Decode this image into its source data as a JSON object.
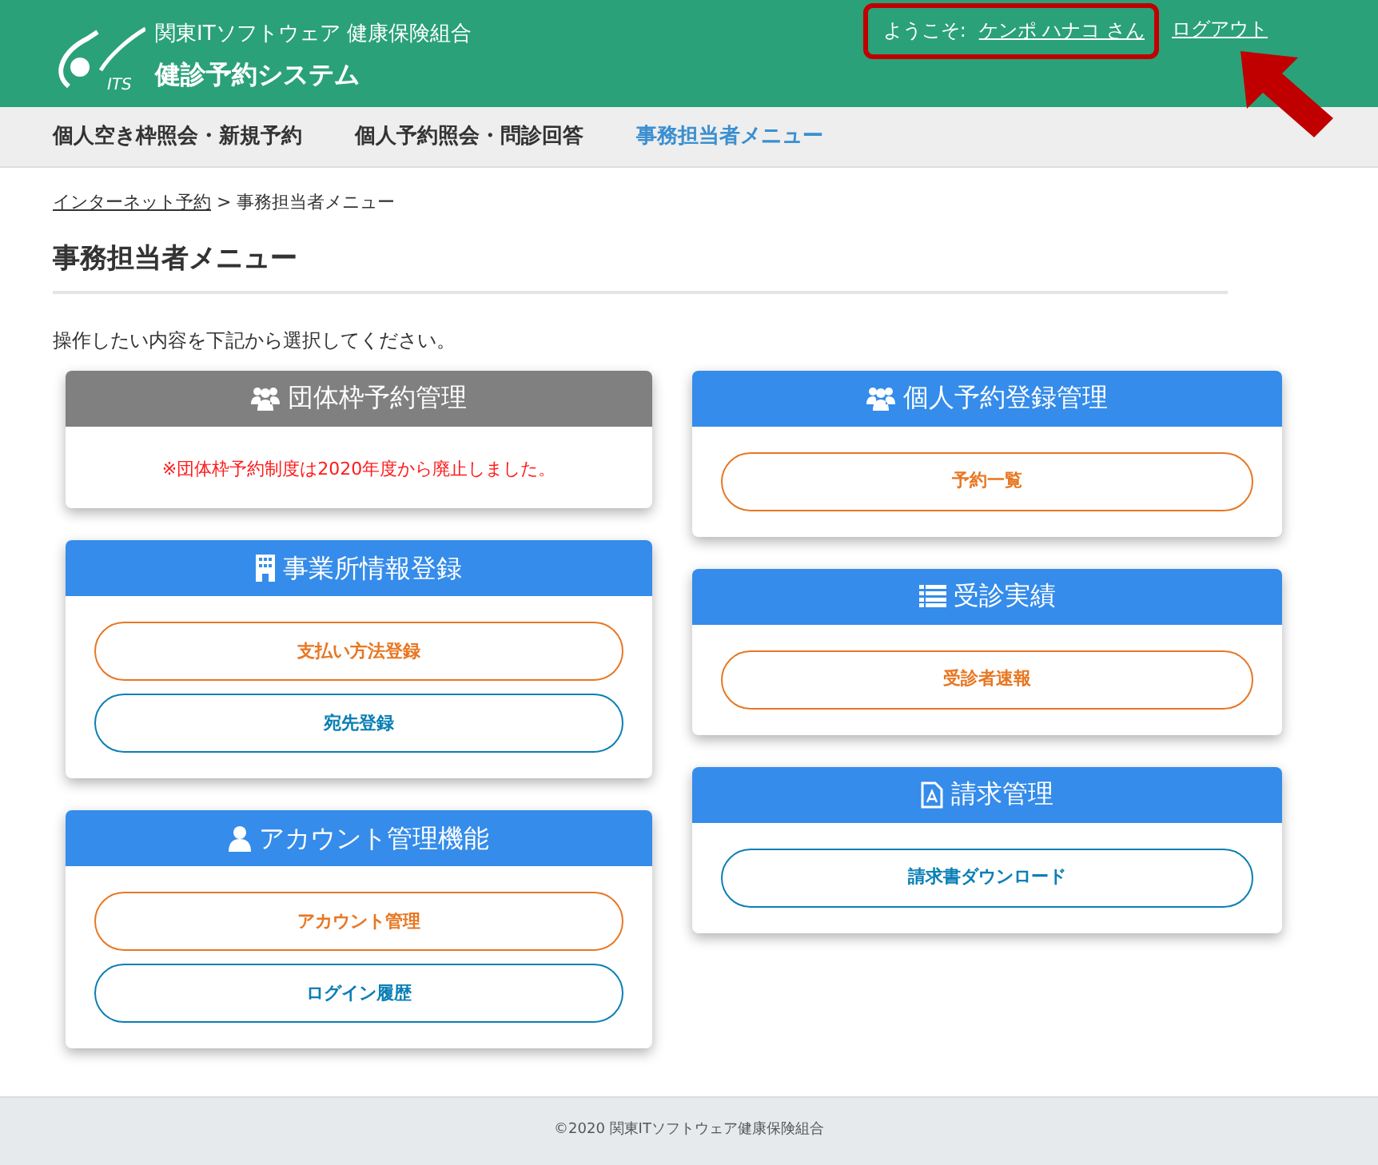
{
  "header": {
    "org": "関東ITソフトウェア 健康保険組合",
    "system": "健診予約システム",
    "logo_text": "ITS",
    "welcome": "ようこそ:",
    "user": "ケンポ ハナコ さん",
    "logout": "ログアウト"
  },
  "nav": [
    {
      "label": "個人空き枠照会・新規予約",
      "selected": false
    },
    {
      "label": "個人予約照会・問診回答",
      "selected": false
    },
    {
      "label": "事務担当者メニュー",
      "selected": true
    }
  ],
  "breadcrumb": {
    "link": "インターネット予約",
    "separator": ">",
    "current": "事務担当者メニュー"
  },
  "title": "事務担当者メニュー",
  "intro": "操作したい内容を下記から選択してください。",
  "columns": [
    [
      {
        "title": "団体枠予約管理",
        "disabled": true,
        "notice": "※団体枠予約制度は2020年度から廃止しました。"
      },
      {
        "title": "事業所情報登録",
        "disabled": false,
        "buttons": [
          {
            "label": "支払い方法登録",
            "color": "#e87722"
          },
          {
            "label": "宛先登録",
            "color": "#0a7fb5"
          }
        ]
      },
      {
        "title": "アカウント管理機能",
        "disabled": false,
        "buttons": [
          {
            "label": "アカウント管理",
            "color": "#e87722"
          },
          {
            "label": "ログイン履歴",
            "color": "#0a7fb5"
          }
        ]
      }
    ],
    [
      {
        "title": "個人予約登録管理",
        "disabled": false,
        "buttons": [
          {
            "label": "予約一覧",
            "color": "#e87722"
          }
        ]
      },
      {
        "title": "受診実績",
        "disabled": false,
        "buttons": [
          {
            "label": "受診者速報",
            "color": "#e87722"
          }
        ]
      },
      {
        "title": "請求管理",
        "disabled": false,
        "buttons": [
          {
            "label": "請求書ダウンロード",
            "color": "#0a7fb5"
          }
        ]
      }
    ]
  ],
  "footer": "©2020 関東ITソフトウェア健康保険組合"
}
